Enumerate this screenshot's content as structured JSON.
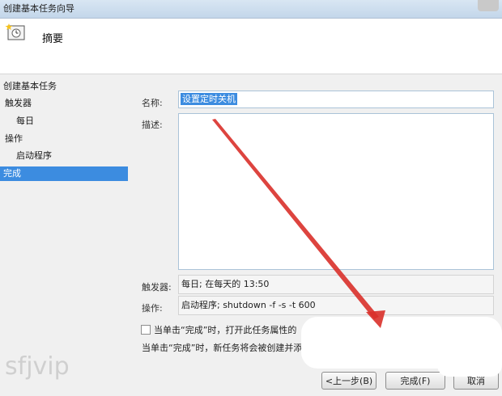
{
  "window": {
    "title": "创建基本任务向导"
  },
  "header": {
    "title": "摘要"
  },
  "sidebar": {
    "items": [
      {
        "label": "创建基本任务"
      },
      {
        "label": "触发器"
      },
      {
        "label": "每日"
      },
      {
        "label": "操作"
      },
      {
        "label": "启动程序"
      },
      {
        "label": "完成"
      }
    ]
  },
  "summary": {
    "name_label": "名称:",
    "name_value": "设置定时关机",
    "desc_label": "描述:",
    "trigger_label": "触发器:",
    "trigger_value": "每日; 在每天的 13:50",
    "action_label": "操作:",
    "action_value": "启动程序; shutdown -f -s -t 600"
  },
  "footer": {
    "checkbox_label": "当单击“完成”时，打开此任务属性的",
    "note": "当单击“完成”时，新任务将会被创建并添",
    "back_button": "<上一步(B)",
    "finish_button": "完成(F)",
    "cancel_button": "取消"
  },
  "watermark": "sfjvip",
  "colors": {
    "selection": "#3c8ce0",
    "arrow": "#d9302a"
  }
}
